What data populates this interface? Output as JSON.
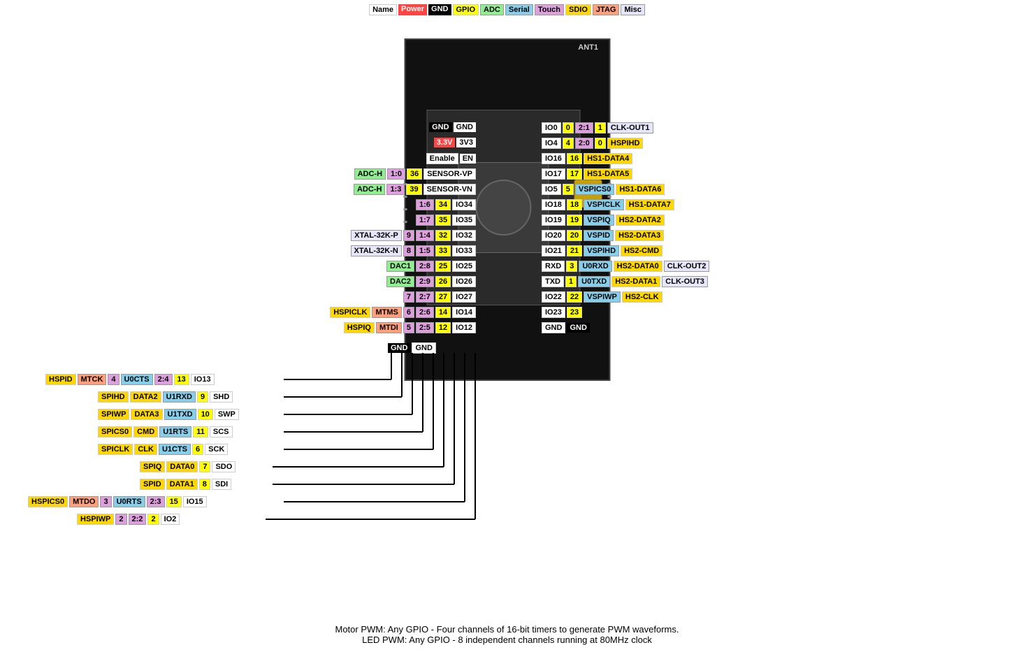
{
  "legend": {
    "items": [
      {
        "label": "Name",
        "class": "color-name"
      },
      {
        "label": "Power",
        "class": "color-power"
      },
      {
        "label": "GND",
        "class": "color-gnd"
      },
      {
        "label": "GPIO",
        "class": "color-gpio"
      },
      {
        "label": "ADC",
        "class": "color-adc"
      },
      {
        "label": "Serial",
        "class": "color-serial"
      },
      {
        "label": "Touch",
        "class": "color-touch"
      },
      {
        "label": "SDIO",
        "class": "color-sdio"
      },
      {
        "label": "JTAG",
        "class": "color-jtag"
      },
      {
        "label": "Misc",
        "class": "color-misc"
      }
    ]
  },
  "footer": {
    "line1": "Motor PWM: Any GPIO - Four channels of 16-bit timers to generate PWM waveforms.",
    "line2": "LED PWM: Any GPIO - 8 independent channels running at 80MHz clock"
  },
  "ant_label": "ANT1"
}
